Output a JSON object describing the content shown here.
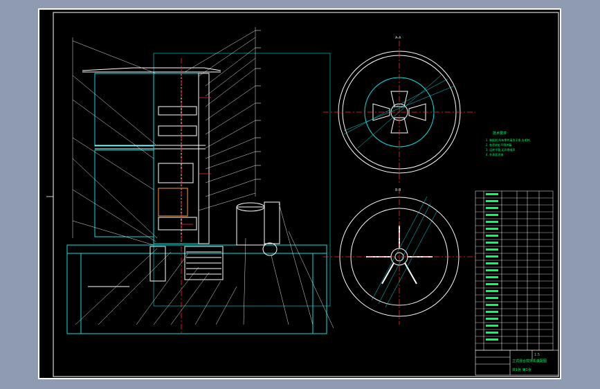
{
  "colors": {
    "background": "#8e9bb0",
    "sheet": "#000000",
    "frame": "#ffffff",
    "outline": "#00e5e5",
    "leader": "#e8e8e8",
    "center_line": "#ff2a2a",
    "note_text": "#00ff66",
    "part": "#ffffff"
  },
  "views": {
    "section": "vertical-section-view",
    "top_view_label": "A-A",
    "bottom_view_label": "B-B"
  },
  "notes": {
    "title": "技术要求",
    "lines": [
      "1. 装配前,所有零件清洗干净,去毛刺.",
      "2. 各密封处不得渗漏.",
      "3. 运转平稳,无异常噪声.",
      "4. 外表面涂漆."
    ]
  },
  "title_block": {
    "name": "立式混合搅拌机装配图",
    "scale": "1:5",
    "sheet": "共1张 第1张"
  }
}
